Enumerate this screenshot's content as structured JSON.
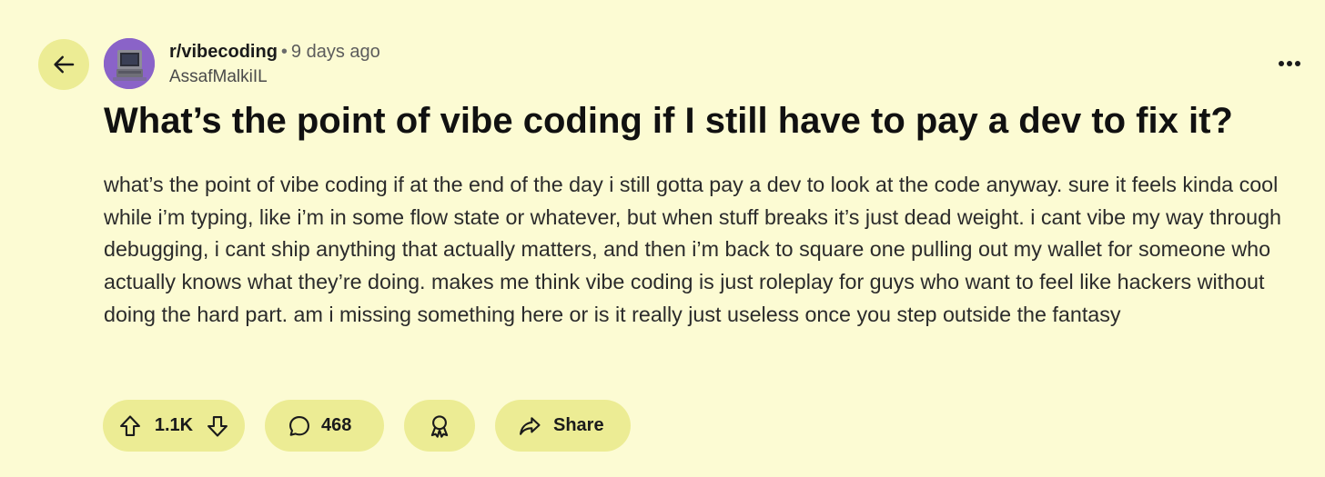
{
  "header": {
    "subreddit": "r/vibecoding",
    "separator": "•",
    "time_ago": "9 days ago",
    "author": "AssafMalkiIL"
  },
  "post": {
    "title": "What’s the point of vibe coding if I still have to pay a dev to fix it?",
    "body": "what’s the point of vibe coding if at the end of the day i still gotta pay a dev to look at the code anyway. sure it feels kinda cool while i’m typing, like i’m in some flow state or whatever, but when stuff breaks it’s just dead weight. i cant vibe my way through debugging, i cant ship anything that actually matters, and then i’m back to square one pulling out my wallet for someone who actually knows what they’re doing. makes me think vibe coding is just roleplay for guys who want to feel like hackers without doing the hard part. am i missing something here or is it really just useless once you step outside the fantasy"
  },
  "actions": {
    "vote_count": "1.1K",
    "comment_count": "468",
    "share_label": "Share"
  },
  "icons": {
    "back": "arrow-left-icon",
    "more": "more-horizontal-icon",
    "upvote": "arrow-up-icon",
    "downvote": "arrow-down-icon",
    "comment": "comment-bubble-icon",
    "award": "award-ribbon-icon",
    "share": "share-arrow-icon"
  },
  "colors": {
    "background": "#fcfbd3",
    "button_bg": "#ecec94",
    "avatar_bg": "#8a63c8"
  }
}
